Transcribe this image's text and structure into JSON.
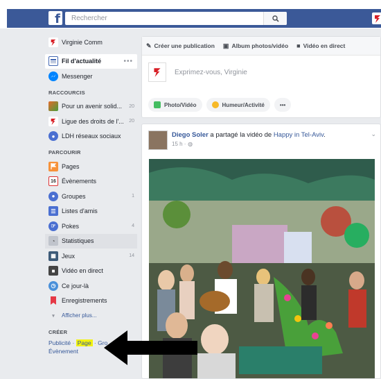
{
  "header": {
    "search_placeholder": "Rechercher",
    "logo_letter": "f"
  },
  "sidebar": {
    "profile": {
      "label": "Virginie Comm"
    },
    "main": [
      {
        "label": "Fil d'actualité",
        "selected": true,
        "more": "•••"
      },
      {
        "label": "Messenger"
      }
    ],
    "shortcuts_title": "RACCOURCIS",
    "shortcuts": [
      {
        "label": "Pour un avenir solid...",
        "count": "20"
      },
      {
        "label": "Ligue des droits de l'...",
        "count": "20"
      },
      {
        "label": "LDH réseaux sociaux",
        "count": ""
      }
    ],
    "explore_title": "PARCOURIR",
    "explore": [
      {
        "label": "Pages",
        "count": ""
      },
      {
        "label": "Évènements",
        "count": "",
        "icon_text": "16"
      },
      {
        "label": "Groupes",
        "count": "1"
      },
      {
        "label": "Listes d'amis",
        "count": ""
      },
      {
        "label": "Pokes",
        "count": "4"
      },
      {
        "label": "Statistiques",
        "count": ""
      },
      {
        "label": "Jeux",
        "count": "14"
      },
      {
        "label": "Vidéo en direct",
        "count": ""
      },
      {
        "label": "Ce jour-là",
        "count": ""
      },
      {
        "label": "Enregistrements",
        "count": ""
      }
    ],
    "show_more": "Afficher plus...",
    "create_title": "CRÉER",
    "create_links": [
      "Publicité",
      "Page",
      "Gro",
      "Évènement"
    ]
  },
  "composer": {
    "tabs": [
      {
        "label": "Créer une publication"
      },
      {
        "label": "Album photos/vidéo"
      },
      {
        "label": "Vidéo en direct"
      }
    ],
    "placeholder": "Exprimez-vous, Virginie",
    "actions": [
      {
        "label": "Photo/Vidéo"
      },
      {
        "label": "Humeur/Activité"
      },
      {
        "label": "•••"
      }
    ]
  },
  "post": {
    "author": "Diego Soler",
    "verb": " a partagé la vidéo de ",
    "page": "Happy in Tel-Aviv",
    "end": ".",
    "time": "15 h ·"
  },
  "colors": {
    "brand": "#3b5998",
    "link": "#365899",
    "background": "#e9ebee",
    "highlight": "#f2f20f"
  }
}
